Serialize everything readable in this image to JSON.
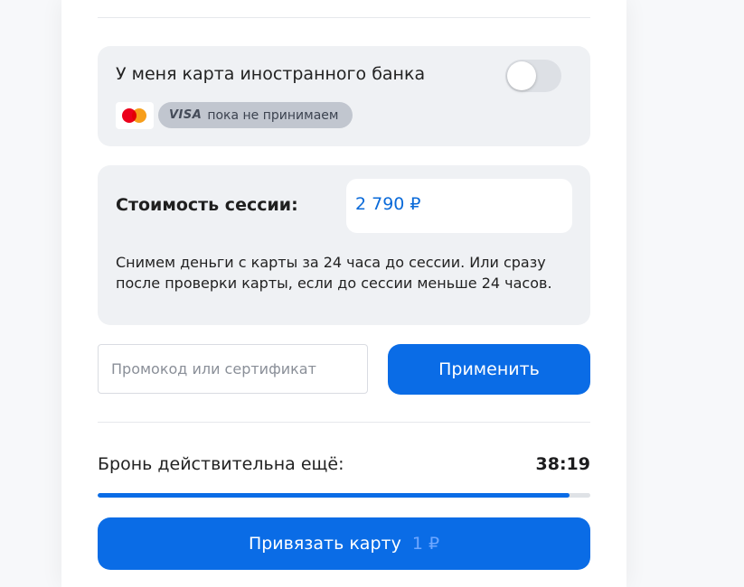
{
  "foreign_card": {
    "label": "У меня карта иностранного банка",
    "toggle_on": false,
    "visa_logo": "VISA",
    "visa_note": "пока не принимаем"
  },
  "session": {
    "cost_label": "Стоимость сессии:",
    "cost_value": "2 790 ₽",
    "note": "Снимем деньги с карты за 24 часа до сессии. Или сразу после проверки карты, если до сессии меньше 24 часов."
  },
  "promo": {
    "placeholder": "Промокод или сертификат",
    "value": "",
    "apply_label": "Применить"
  },
  "booking": {
    "label": "Бронь действительна ещё:",
    "timer": "38:19",
    "progress": 0.957
  },
  "bind_card": {
    "label": "Привязать карту",
    "price": "1 ₽"
  },
  "colors": {
    "accent": "#0a6ce6",
    "card_bg": "#eff1f4",
    "price_text": "#0a6ad9"
  }
}
